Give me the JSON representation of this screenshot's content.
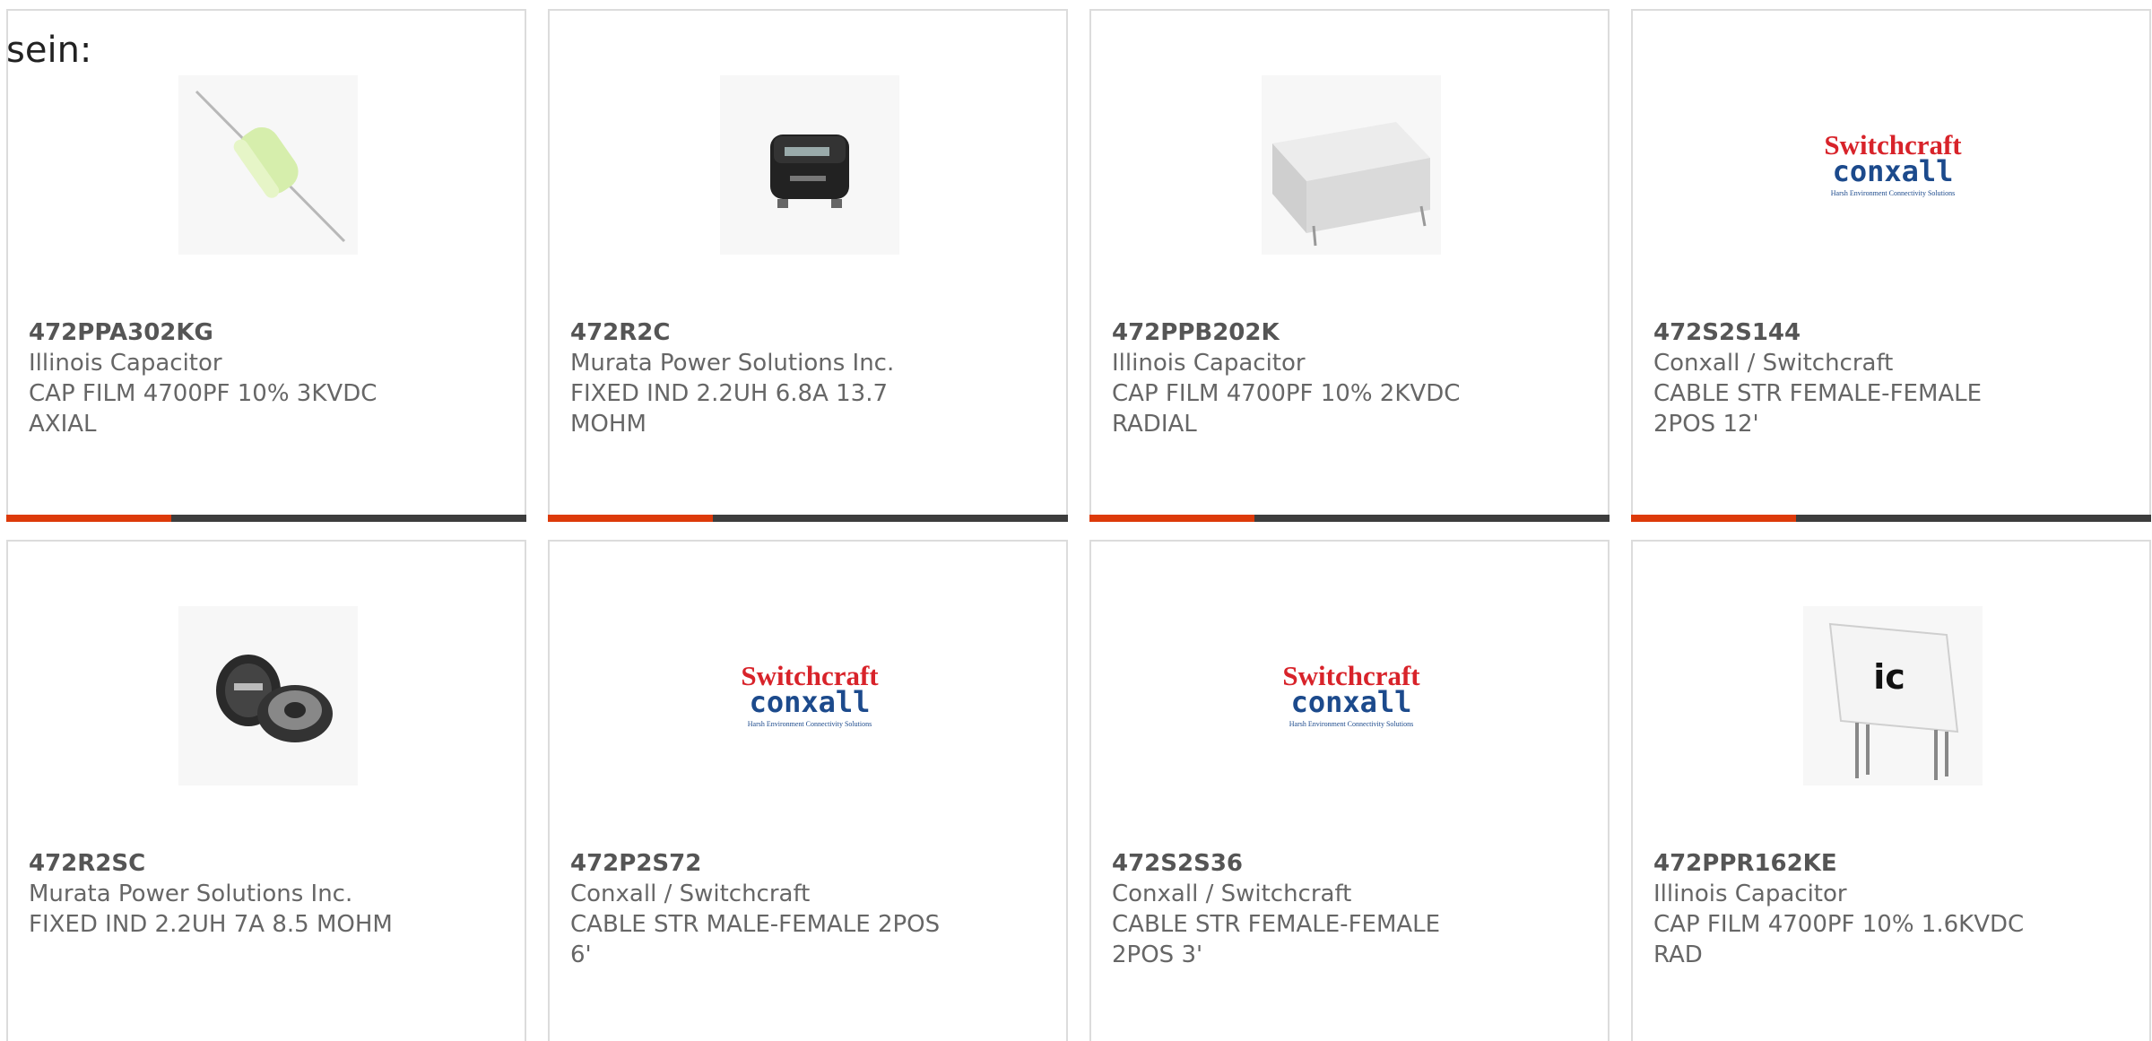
{
  "lead_text": "sein:",
  "colors": {
    "accent": "#dd3a0a",
    "bar": "#3d3d3d",
    "border": "#dcdcdc",
    "text": "#666666"
  },
  "products": [
    {
      "part_number": "472PPA302KG",
      "manufacturer": "Illinois Capacitor",
      "description_line1": "CAP FILM 4700PF 10% 3KVDC",
      "description_line2": "AXIAL",
      "image": "axial-film-capacitor"
    },
    {
      "part_number": "472R2C",
      "manufacturer": "Murata Power Solutions Inc.",
      "description_line1": "FIXED IND 2.2UH 6.8A 13.7",
      "description_line2": "MOHM",
      "image": "smd-inductor"
    },
    {
      "part_number": "472PPB202K",
      "manufacturer": "Illinois Capacitor",
      "description_line1": "CAP FILM 4700PF 10% 2KVDC",
      "description_line2": "RADIAL",
      "image": "box-film-capacitor"
    },
    {
      "part_number": "472S2S144",
      "manufacturer": "Conxall / Switchcraft",
      "description_line1": "CABLE STR FEMALE-FEMALE",
      "description_line2": "2POS 12'",
      "image": "switchcraft-conxall-logo"
    },
    {
      "part_number": "472R2SC",
      "manufacturer": "Murata Power Solutions Inc.",
      "description_line1": "FIXED IND 2.2UH 7A 8.5 MOHM",
      "description_line2": "",
      "image": "drum-inductor"
    },
    {
      "part_number": "472P2S72",
      "manufacturer": "Conxall / Switchcraft",
      "description_line1": "CABLE STR MALE-FEMALE 2POS",
      "description_line2": "6'",
      "image": "switchcraft-conxall-logo"
    },
    {
      "part_number": "472S2S36",
      "manufacturer": "Conxall / Switchcraft",
      "description_line1": "CABLE STR FEMALE-FEMALE",
      "description_line2": "2POS 3'",
      "image": "switchcraft-conxall-logo"
    },
    {
      "part_number": "472PPR162KE",
      "manufacturer": "Illinois Capacitor",
      "description_line1": "CAP FILM 4700PF 10% 1.6KVDC",
      "description_line2": "RAD",
      "image": "ic-radial-capacitor"
    }
  ],
  "logo": {
    "line1": "Switchcraft",
    "line2": "conxall",
    "tagline": "Harsh Environment Connectivity Solutions"
  },
  "ic_logo_text": "ic"
}
